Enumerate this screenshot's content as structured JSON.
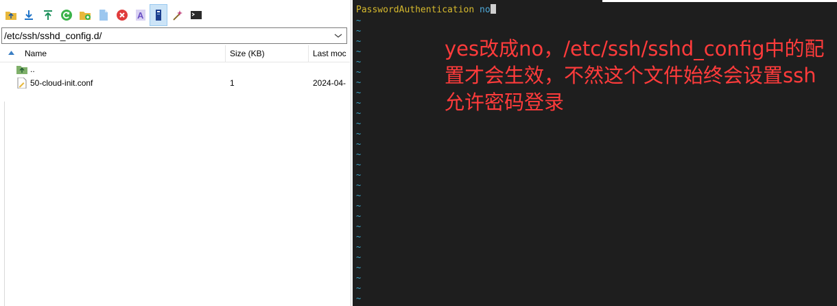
{
  "toolbar": {
    "buttons": [
      {
        "name": "parent-folder-icon",
        "color": "#e8b83c"
      },
      {
        "name": "download-icon",
        "color": "#1e73c8"
      },
      {
        "name": "upload-icon",
        "color": "#1b8f5a"
      },
      {
        "name": "refresh-icon",
        "color": "#3bb34a"
      },
      {
        "name": "new-folder-icon",
        "color": "#e8b83c"
      },
      {
        "name": "new-file-icon",
        "color": "#9cc7ef"
      },
      {
        "name": "delete-icon",
        "color": "#e03c3c"
      },
      {
        "name": "rename-icon",
        "color": "#6a4fc4"
      },
      {
        "name": "properties-icon",
        "color": "#1d3f8f"
      },
      {
        "name": "tools-icon",
        "color": "#c0407a"
      },
      {
        "name": "terminal-icon",
        "color": "#2b2b2b"
      }
    ]
  },
  "path": {
    "value": "/etc/ssh/sshd_config.d/"
  },
  "columns": {
    "name": "Name",
    "size": "Size (KB)",
    "modified": "Last moc"
  },
  "files": [
    {
      "name": "..",
      "size": "",
      "modified": "",
      "icon": "parent-folder-icon"
    },
    {
      "name": "50-cloud-init.conf",
      "size": "1",
      "modified": "2024-04-",
      "icon": "file-icon"
    }
  ],
  "terminal": {
    "keyword": "PasswordAuthentication",
    "value": "no",
    "tilde": "~",
    "colors": {
      "keyword": "#d7ba2e",
      "value": "#4fa9d8",
      "tilde": "#3aa6c9",
      "background": "#1e1e1e"
    }
  },
  "annotation": {
    "text": "yes改成no，/etc/ssh/sshd_config中的配置才会生效，不然这个文件始终会设置ssh允许密码登录",
    "color": "#ff3b3b"
  }
}
